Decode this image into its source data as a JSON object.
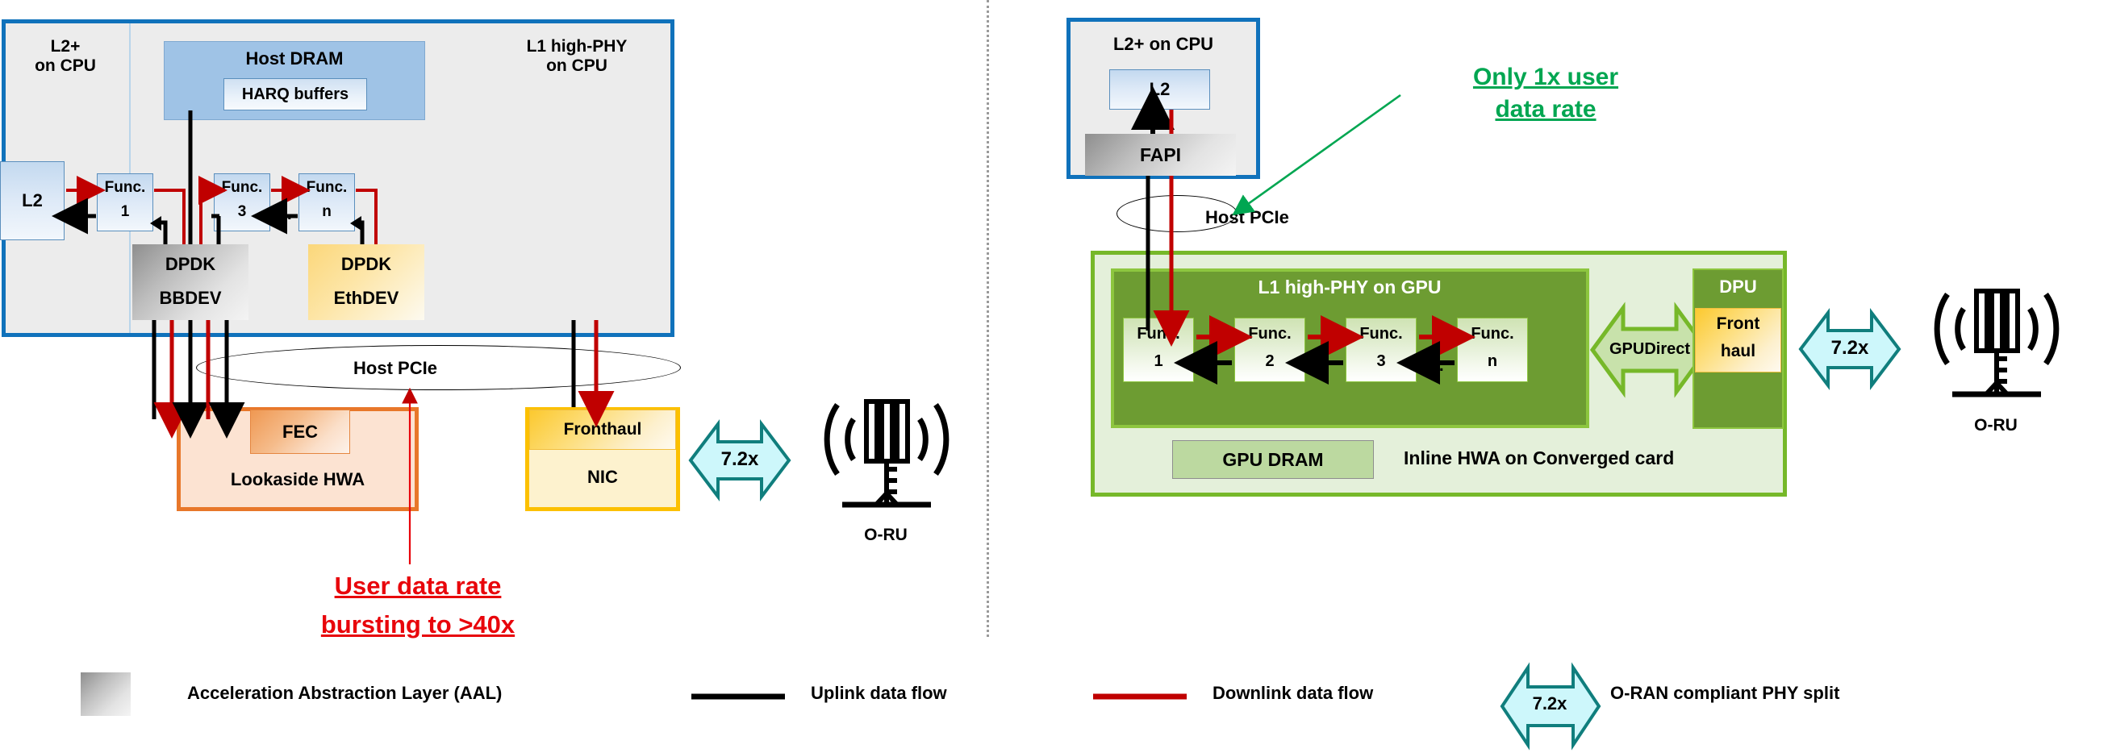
{
  "left_panel": {
    "cpu_frame": {
      "left_label": "L2+\non CPU",
      "right_label": "L1 high-PHY\non CPU",
      "border_color": "#1072bb"
    },
    "host_dram": {
      "title": "Host DRAM",
      "harq": "HARQ buffers"
    },
    "l2_box": "L2",
    "functions": [
      {
        "name": "Func.",
        "index": "1"
      },
      {
        "name": "Func.",
        "index": "3"
      },
      {
        "name": "Func.",
        "index": "n"
      }
    ],
    "ellipsis": "...",
    "dpdk_bbdev": {
      "line1": "DPDK",
      "line2": "BBDEV"
    },
    "dpdk_ethdev": {
      "line1": "DPDK",
      "line2": "EthDEV"
    },
    "host_pcie": "Host PCIe",
    "lookaside": {
      "fec": "FEC",
      "title": "Lookaside HWA"
    },
    "nic": {
      "fronthaul": "Fronthaul",
      "title": "NIC"
    },
    "split_badge": "7.2x",
    "oru_label": "O-RU",
    "annotation": {
      "line1": "User data rate",
      "line2": "bursting to >40x",
      "color": "#e8050b"
    }
  },
  "right_panel": {
    "cpu_frame": {
      "label": "L2+ on CPU",
      "border_color": "#1072bb"
    },
    "l2_box": "L2",
    "fapi": "FAPI",
    "host_pcie": "Host PCIe",
    "annotation": {
      "line1": "Only 1x user",
      "line2": "data rate",
      "color": "#00a651"
    },
    "converged": {
      "gpu_title": "L1 high-PHY on GPU",
      "functions": [
        {
          "name": "Func.",
          "index": "1"
        },
        {
          "name": "Func.",
          "index": "2"
        },
        {
          "name": "Func.",
          "index": "3"
        },
        {
          "name": "Func.",
          "index": "n"
        }
      ],
      "ellipsis": "...",
      "gpudirect": "GPUDirect",
      "dpu": "DPU",
      "fronthaul": {
        "line1": "Front",
        "line2": "haul"
      },
      "gpu_dram": "GPU DRAM",
      "title": "Inline HWA on Converged card"
    },
    "split_badge": "7.2x",
    "oru_label": "O-RU"
  },
  "legend": {
    "aal": "Acceleration Abstraction Layer (AAL)",
    "uplink": "Uplink data flow",
    "uplink_color": "#000000",
    "downlink": "Downlink data flow",
    "downlink_color": "#c00000",
    "split_badge": "7.2x",
    "split_label": "O-RAN compliant PHY split"
  }
}
